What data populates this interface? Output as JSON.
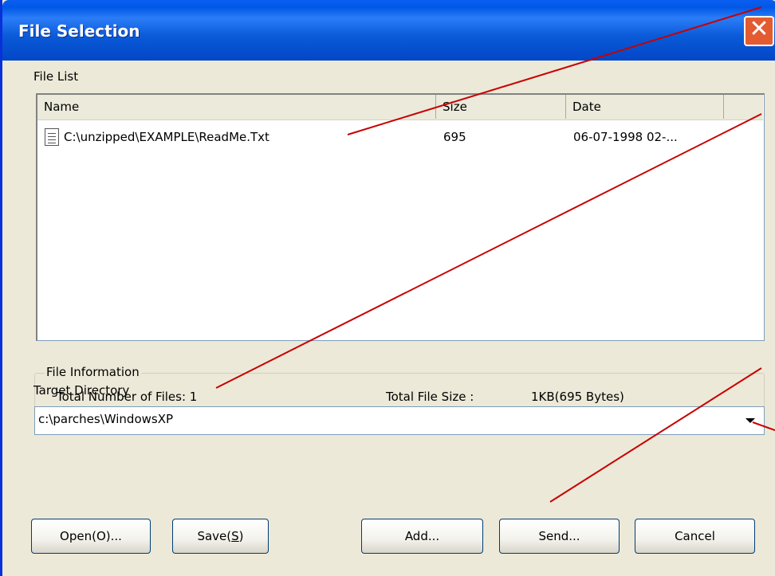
{
  "dialog": {
    "title": "File Selection",
    "close_glyph": "✕"
  },
  "file_list": {
    "label": "File List",
    "columns": [
      "Name",
      "Size",
      "Date"
    ],
    "rows": [
      {
        "name": "C:\\unzipped\\EXAMPLE\\ReadMe.Txt",
        "size": "695",
        "date": "06-07-1998 02-..."
      }
    ]
  },
  "file_information": {
    "label": "File Information",
    "total_files": "Total Number of Files: 1",
    "total_size_label": "Total File Size :",
    "total_size_value": "1KB(695 Bytes)"
  },
  "target_directory": {
    "label": "Target Directory",
    "value": "c:\\parches\\WindowsXP"
  },
  "buttons": {
    "open": "Open(O)...",
    "save_prefix": "Save(",
    "save_key": "S",
    "save_suffix": ")",
    "add": "Add...",
    "send": "Send...",
    "cancel": "Cancel"
  },
  "colors": {
    "title_bar": "#0058e6",
    "annotation_line": "#c80000",
    "close_button": "#e35c31",
    "window_face": "#ece9d8"
  }
}
